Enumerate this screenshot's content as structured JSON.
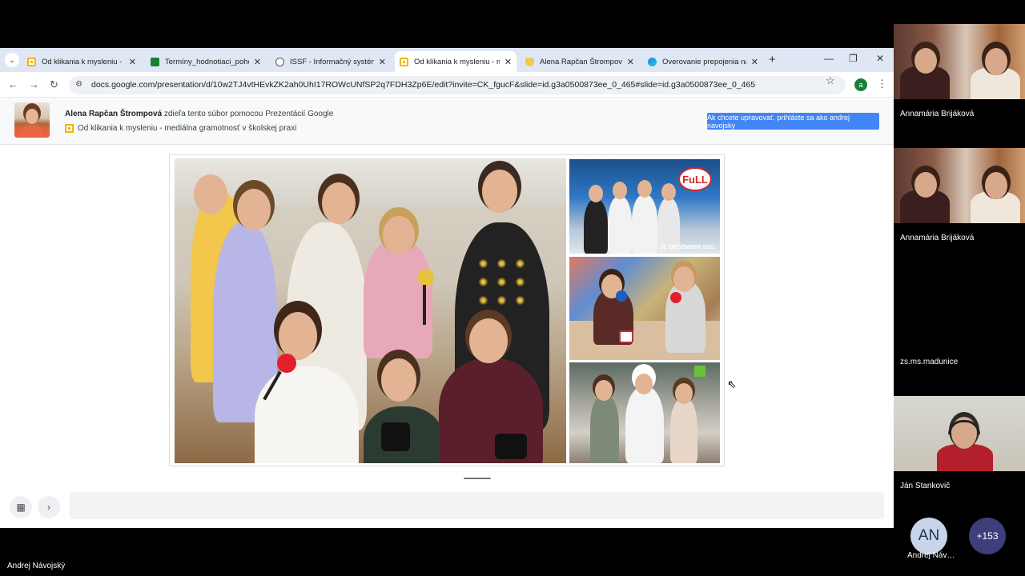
{
  "browser": {
    "tabs": [
      {
        "title": "Od klikania k mysleniu - m",
        "favicon": "slides-icon"
      },
      {
        "title": "Termíny_hodnotiaci_pohov",
        "favicon": "sheets-icon"
      },
      {
        "title": "ISSF - Informačný systém",
        "favicon": "globe-icon"
      },
      {
        "title": "Od klikania k mysleniu - m",
        "favicon": "slides-icon",
        "active": true
      },
      {
        "title": "Alena Rapčan Štrompová",
        "favicon": "shield-icon"
      },
      {
        "title": "Overovanie prepojenia na",
        "favicon": "edge-icon"
      }
    ],
    "new_tab": "+",
    "minimize": "—",
    "restore": "❐",
    "close": "✕",
    "url": "docs.google.com/presentation/d/10w2TJ4vtHEvkZK2ah0UhI17ROWcUNfSP2q7FDH3Zp6E/edit?invite=CK_fgucF&slide=id.g3a0500873ee_0_465#slide=id.g3a0500873ee_0_465",
    "profile_initial": "a"
  },
  "share": {
    "owner": "Alena Rapčan Štrompová",
    "message": " zdieľa tento súbor pomocou Prezentácií Google",
    "doc_title": "Od klikania k mysleniu - mediálna gramotnosť v školskej praxi",
    "login_button": "Ak chcete upravovať, prihláste sa ako andrej navojsky"
  },
  "slide": {
    "tv_caption": "16. DECEMBER 2021",
    "tv_logo": "FuLL"
  },
  "meeting": {
    "participants": [
      {
        "name": "Annamária Brijáková"
      },
      {
        "name": "Annamária Brijáková"
      },
      {
        "name": "zs.ms.madunice"
      },
      {
        "name": "Ján Stankovič"
      }
    ],
    "avatar_initials": "AN",
    "avatar_name": "Andrej Návojský",
    "more_count": "+153",
    "presenter": "Andrej Návojský"
  }
}
